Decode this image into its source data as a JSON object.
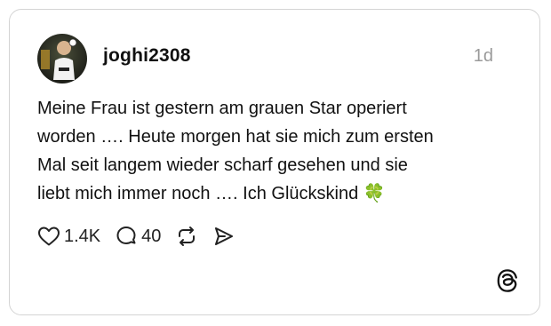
{
  "post": {
    "username": "joghi2308",
    "timestamp": "1d",
    "text_lines": [
      "Meine Frau ist gestern am grauen Star operiert",
      "worden …. Heute morgen hat sie mich zum ersten",
      "Mal seit langem wieder scharf gesehen und sie",
      "liebt mich immer noch …. Ich Glückskind 🍀"
    ]
  },
  "actions": {
    "likes": "1.4K",
    "comments": "40",
    "icons": [
      "heart-icon",
      "comment-icon",
      "repost-icon",
      "share-icon"
    ]
  },
  "brand": {
    "logo": "threads-logo-icon",
    "text_color": "#111111",
    "muted_color": "#9a9a9a",
    "border_color": "#d4d4d4"
  }
}
